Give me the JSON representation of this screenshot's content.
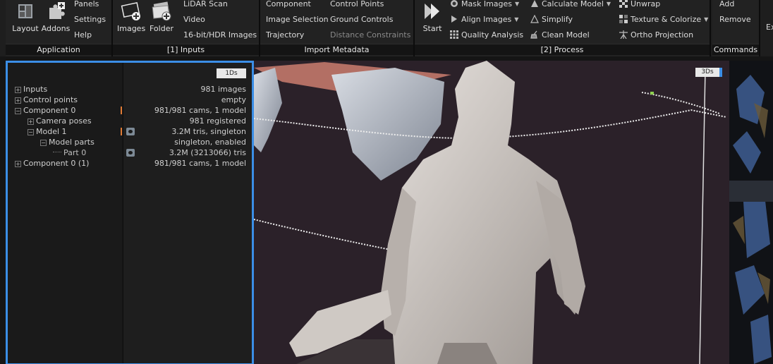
{
  "ribbon": {
    "application": {
      "label": "Application",
      "layout": "Layout",
      "addons": "Addons",
      "panels": "Panels",
      "settings": "Settings",
      "help": "Help"
    },
    "inputs": {
      "label": "[1] Inputs",
      "images": "Images",
      "folder": "Folder",
      "lidar": "LiDAR Scan",
      "video": "Video",
      "hdr": "16-bit/HDR Images"
    },
    "import_metadata": {
      "label": "Import Metadata",
      "component": "Component",
      "image_selection": "Image Selection",
      "trajectory": "Trajectory",
      "control_points": "Control Points",
      "ground_controls": "Ground Controls",
      "distance_constraints": "Distance Constraints"
    },
    "process": {
      "label": "[2] Process",
      "start": "Start",
      "mask_images": "Mask Images",
      "align_images": "Align Images",
      "quality_analysis": "Quality Analysis",
      "calculate_model": "Calculate Model",
      "simplify": "Simplify",
      "clean_model": "Clean Model",
      "unwrap": "Unwrap",
      "texture_colorize": "Texture & Colorize",
      "ortho_projection": "Ortho Projection"
    },
    "commands": {
      "label": "Commands",
      "add": "Add",
      "remove": "Remove"
    },
    "overflow": "Ex"
  },
  "left_panel": {
    "badge": "1Ds",
    "rows": [
      {
        "label": "Inputs",
        "value": "981 images"
      },
      {
        "label": "Control points",
        "value": "empty"
      },
      {
        "label": "Component 0",
        "value": "981/981 cams, 1 model"
      },
      {
        "label": "Camera poses",
        "value": "981 registered"
      },
      {
        "label": "Model 1",
        "value": "3.2M tris, singleton"
      },
      {
        "label": "Model parts",
        "value": "singleton, enabled"
      },
      {
        "label": "Part 0",
        "value": "3.2M (3213066) tris"
      },
      {
        "label": "Component 0 (1)",
        "value": "981/981 cams, 1 model"
      }
    ]
  },
  "viewport": {
    "badge": "3Ds"
  },
  "colors": {
    "accent": "#3b8ee6",
    "orange": "#e07b35"
  }
}
